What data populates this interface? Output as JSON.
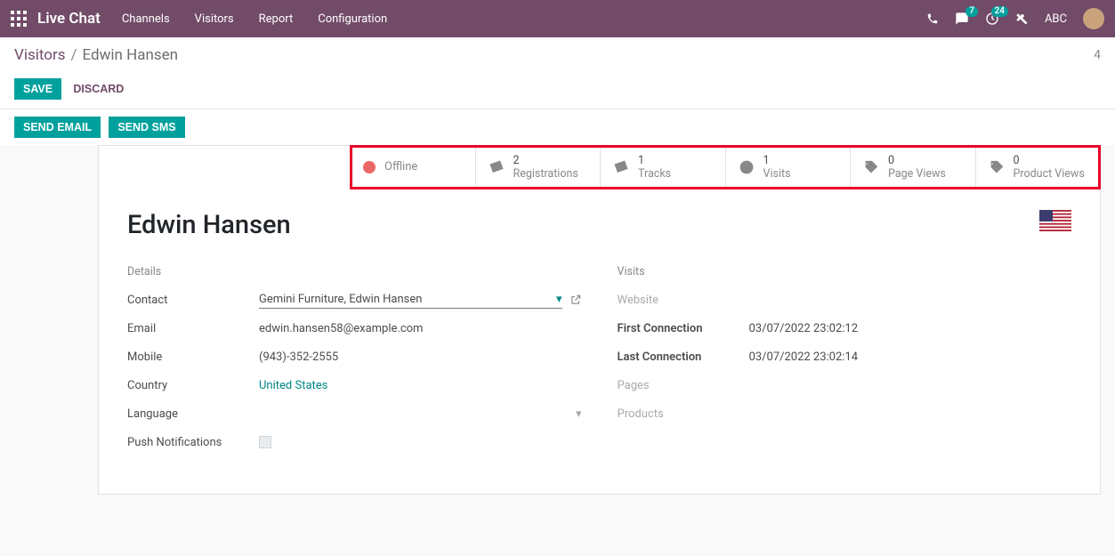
{
  "navbar": {
    "brand": "Live Chat",
    "menu": [
      "Channels",
      "Visitors",
      "Report",
      "Configuration"
    ],
    "msg_badge": "7",
    "clock_badge": "24",
    "user": "ABC"
  },
  "breadcrumb": {
    "parent": "Visitors",
    "current": "Edwin Hansen",
    "count": "4"
  },
  "actions": {
    "save": "Save",
    "discard": "Discard",
    "send_email": "Send Email",
    "send_sms": "Send SMS"
  },
  "stats": {
    "status": "Offline",
    "registrations": {
      "count": "2",
      "label": "Registrations"
    },
    "tracks": {
      "count": "1",
      "label": "Tracks"
    },
    "visits": {
      "count": "1",
      "label": "Visits"
    },
    "page_views": {
      "count": "0",
      "label": "Page Views"
    },
    "product_views": {
      "count": "0",
      "label": "Product Views"
    }
  },
  "record": {
    "name": "Edwin Hansen",
    "details": {
      "section": "Details",
      "contact_label": "Contact",
      "contact_value": "Gemini Furniture, Edwin Hansen",
      "email_label": "Email",
      "email_value": "edwin.hansen58@example.com",
      "mobile_label": "Mobile",
      "mobile_value": "(943)-352-2555",
      "country_label": "Country",
      "country_value": "United States",
      "language_label": "Language",
      "language_value": "",
      "push_label": "Push Notifications"
    },
    "visits": {
      "section": "Visits",
      "website_label": "Website",
      "first_conn_label": "First Connection",
      "first_conn_value": "03/07/2022 23:02:12",
      "last_conn_label": "Last Connection",
      "last_conn_value": "03/07/2022 23:02:14",
      "pages_label": "Pages",
      "products_label": "Products"
    }
  }
}
